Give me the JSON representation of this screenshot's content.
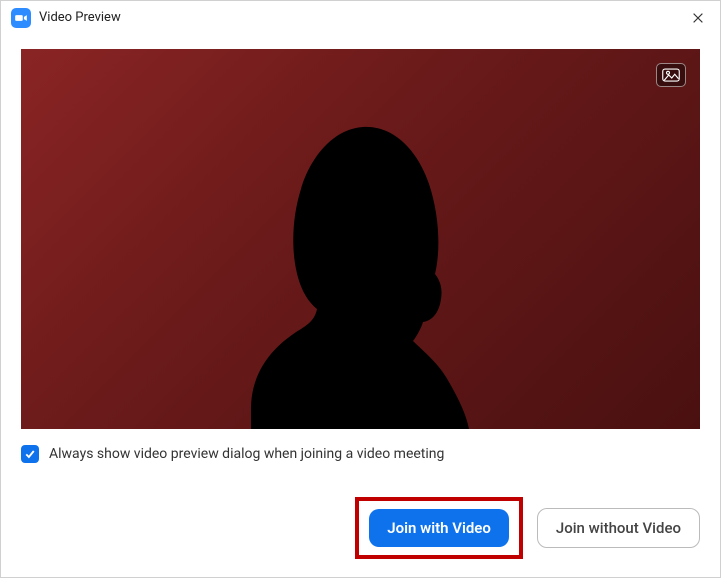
{
  "titlebar": {
    "title": "Video Preview"
  },
  "checkbox": {
    "label": "Always show video preview dialog when joining a video meeting",
    "checked": true
  },
  "buttons": {
    "primary": "Join with Video",
    "secondary": "Join without Video"
  }
}
